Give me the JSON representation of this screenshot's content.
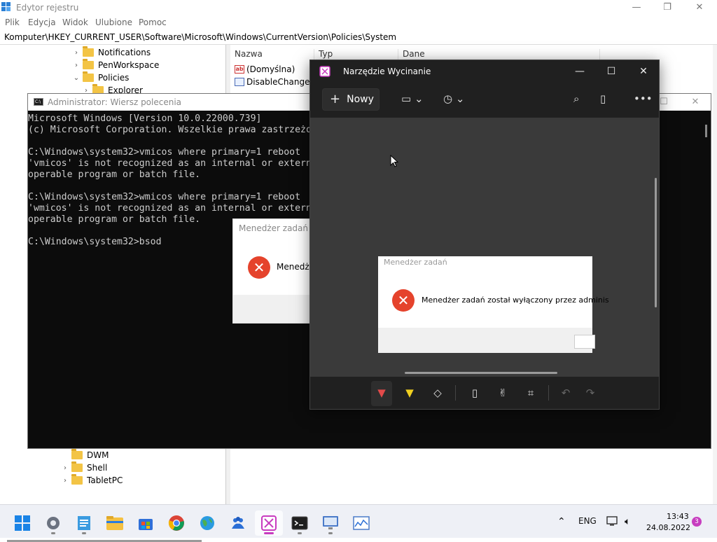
{
  "registry": {
    "title": "Edytor rejestru",
    "menu": [
      "Plik",
      "Edycja",
      "Widok",
      "Ulubione",
      "Pomoc"
    ],
    "address": "Komputer\\HKEY_CURRENT_USER\\Software\\Microsoft\\Windows\\CurrentVersion\\Policies\\System",
    "tree_top": [
      {
        "label": "Notifications",
        "chevron": "›"
      },
      {
        "label": "PenWorkspace",
        "chevron": "›"
      },
      {
        "label": "Policies",
        "chevron": "⌄"
      },
      {
        "label": "Explorer",
        "chevron": "›"
      }
    ],
    "tree_bottom": [
      {
        "label": "DWM",
        "chevron": ""
      },
      {
        "label": "Shell",
        "chevron": "›"
      },
      {
        "label": "TabletPC",
        "chevron": "›"
      }
    ],
    "columns": [
      "Nazwa",
      "Typ",
      "Dane"
    ],
    "values": [
      {
        "name": "(Domyślna)",
        "icon": "string-value-icon"
      },
      {
        "name": "DisableChangeP...",
        "icon": "binary-value-icon"
      }
    ]
  },
  "cmd": {
    "title": "Administrator: Wiersz polecenia",
    "lines": [
      "Microsoft Windows [Version 10.0.22000.739]",
      "(c) Microsoft Corporation. Wszelkie prawa zastrzeżone.",
      "",
      "C:\\Windows\\system32>vmicos where primary=1 reboot",
      "'vmicos' is not recognized as an internal or external command,",
      "operable program or batch file.",
      "",
      "C:\\Windows\\system32>wmicos where primary=1 reboot",
      "'wmicos' is not recognized as an internal or external command,",
      "operable program or batch file.",
      "",
      "C:\\Windows\\system32>bsod"
    ]
  },
  "task_manager_dialog": {
    "title": "Menedżer zadań",
    "message_partial": "Menedże"
  },
  "snipping_tool": {
    "title": "Narzędzie Wycinanie",
    "new_button": "Nowy",
    "captured_dialog": {
      "title": "Menedżer zadań",
      "message": "Menedżer zadań został wyłączony przez adminis"
    }
  },
  "taskbar": {
    "apps": [
      "start",
      "settings",
      "notepad",
      "file-explorer",
      "store",
      "chrome",
      "edge-globe",
      "teams",
      "snipping-tool",
      "terminal",
      "remote-desktop",
      "resource-monitor"
    ],
    "active_app": "snipping-tool",
    "language": "ENG",
    "time": "13:43",
    "date": "24.08.2022",
    "notification_count": "3"
  },
  "colors": {
    "error_red": "#e5432c",
    "snip_accent": "#c83bbf",
    "folder_yellow": "#f3c445"
  }
}
